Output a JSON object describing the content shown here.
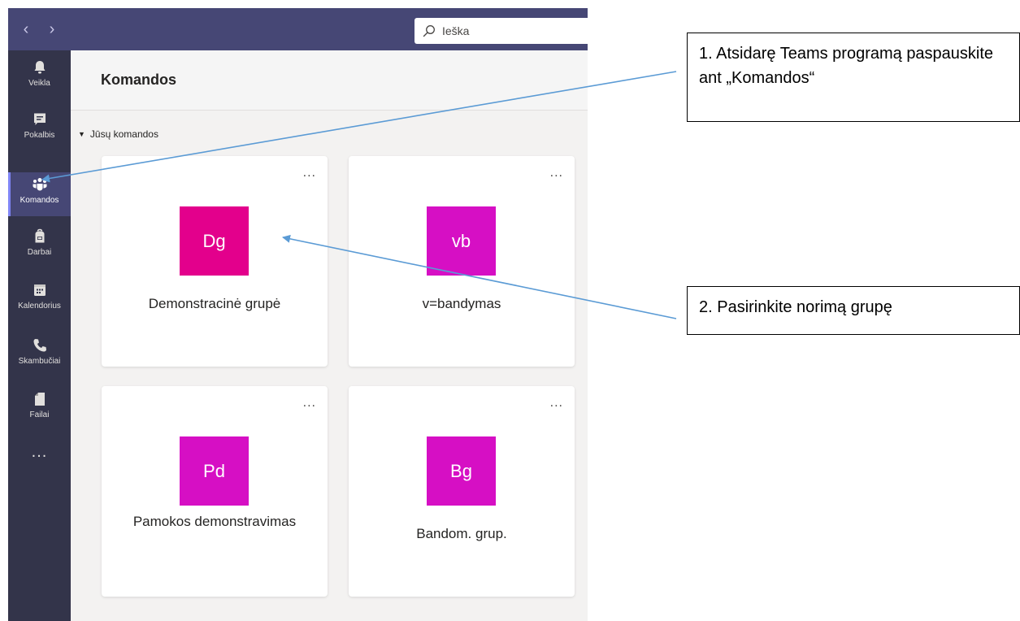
{
  "topbar": {
    "back_icon": "chevron-left-icon",
    "forward_icon": "chevron-right-icon",
    "search": {
      "icon": "search-icon",
      "label": "Ieška"
    }
  },
  "rail": {
    "items": [
      {
        "label": "Veikla",
        "icon": "bell-icon",
        "active": false
      },
      {
        "label": "Pokalbis",
        "icon": "chat-icon",
        "active": false
      },
      {
        "label": "Komandos",
        "icon": "teams-icon",
        "active": true
      },
      {
        "label": "Darbai",
        "icon": "backpack-icon",
        "active": false
      },
      {
        "label": "Kalendorius",
        "icon": "calendar-icon",
        "active": false
      },
      {
        "label": "Skambučiai",
        "icon": "phone-icon",
        "active": false
      },
      {
        "label": "Failai",
        "icon": "file-icon",
        "active": false
      }
    ],
    "more": "..."
  },
  "main": {
    "title": "Komandos",
    "section_label": "Jūsų komandos",
    "teams": [
      {
        "initials": "Dg",
        "name": "Demonstracinė grupė",
        "color": "#e3008c"
      },
      {
        "initials": "vb",
        "name": "v=bandymas",
        "color": "#d60fc4"
      },
      {
        "initials": "Pd",
        "name": "Pamokos demonstravimas",
        "color": "#d60fc4"
      },
      {
        "initials": "Bg",
        "name": "Bandom. grup.",
        "color": "#d60fc4"
      }
    ],
    "card_more": "..."
  },
  "callouts": {
    "step1": "1. Atsidarę Teams programą paspauskite ant „Komandos“",
    "step2": "2. Pasirinkite norimą grupę"
  },
  "colors": {
    "topbar": "#464775",
    "rail": "#33344a",
    "arrow": "#5b9bd5"
  }
}
